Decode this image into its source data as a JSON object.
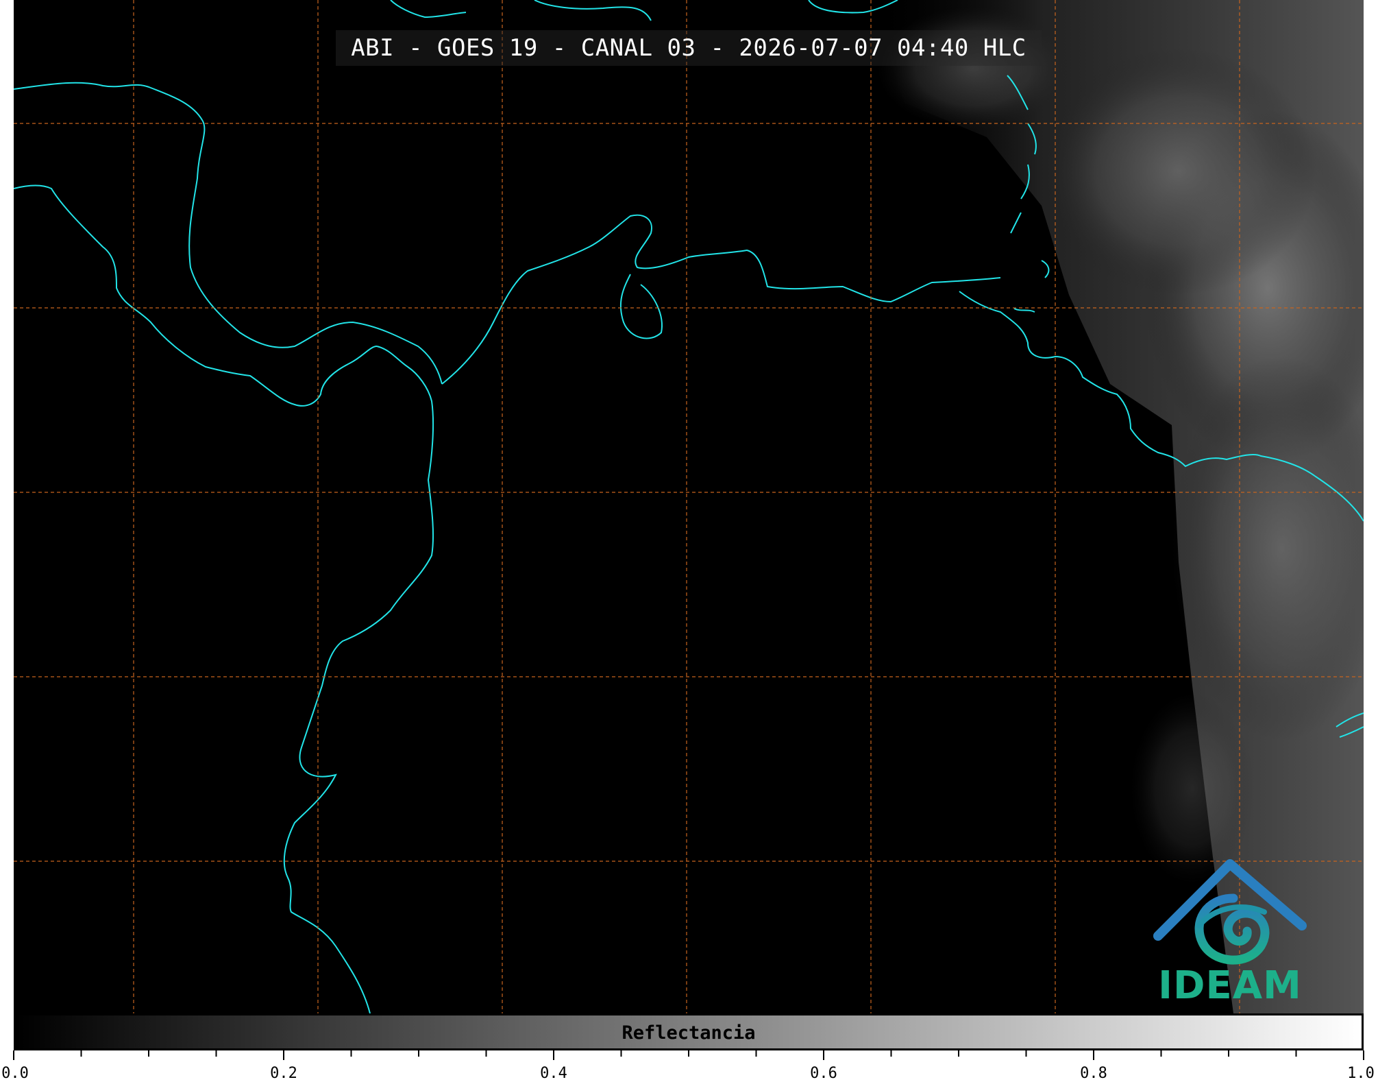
{
  "title": "ABI - GOES 19 - CANAL 03 - 2026-07-07 04:40 HLC",
  "colorbar": {
    "label": "Reflectancia",
    "range": [
      0.0,
      1.0
    ],
    "ticks": [
      "0.0",
      "0.2",
      "0.4",
      "0.6",
      "0.8",
      "1.0"
    ],
    "colormap": "grayscale"
  },
  "logo": {
    "text": "IDEAM"
  },
  "colors": {
    "coastline": "#22e4e8",
    "gridline": "#c8641e",
    "background": "#000000",
    "logo_green": "#1db08a",
    "logo_blue": "#2a7fc0"
  },
  "grid": {
    "style": "dashed"
  }
}
